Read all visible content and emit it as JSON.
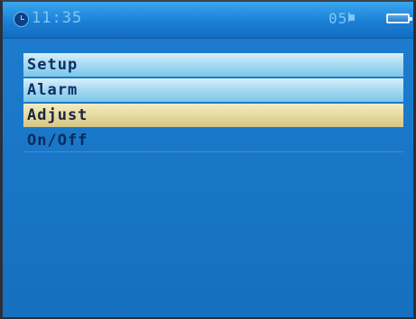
{
  "status_bar": {
    "time": "11:35",
    "volume": "05",
    "icons": [
      "clock-icon",
      "speaker-icon",
      "battery-icon"
    ]
  },
  "menu": {
    "items": [
      {
        "label": "Setup",
        "state": "normal"
      },
      {
        "label": "Alarm",
        "state": "normal"
      },
      {
        "label": "Adjust",
        "state": "selected"
      },
      {
        "label": "On/Off",
        "state": "normal"
      }
    ]
  },
  "colors": {
    "background": "#1a78c9",
    "item_highlight": "#a9dbf2",
    "item_selected": "#e6daa0",
    "text": "#0c2f66"
  }
}
